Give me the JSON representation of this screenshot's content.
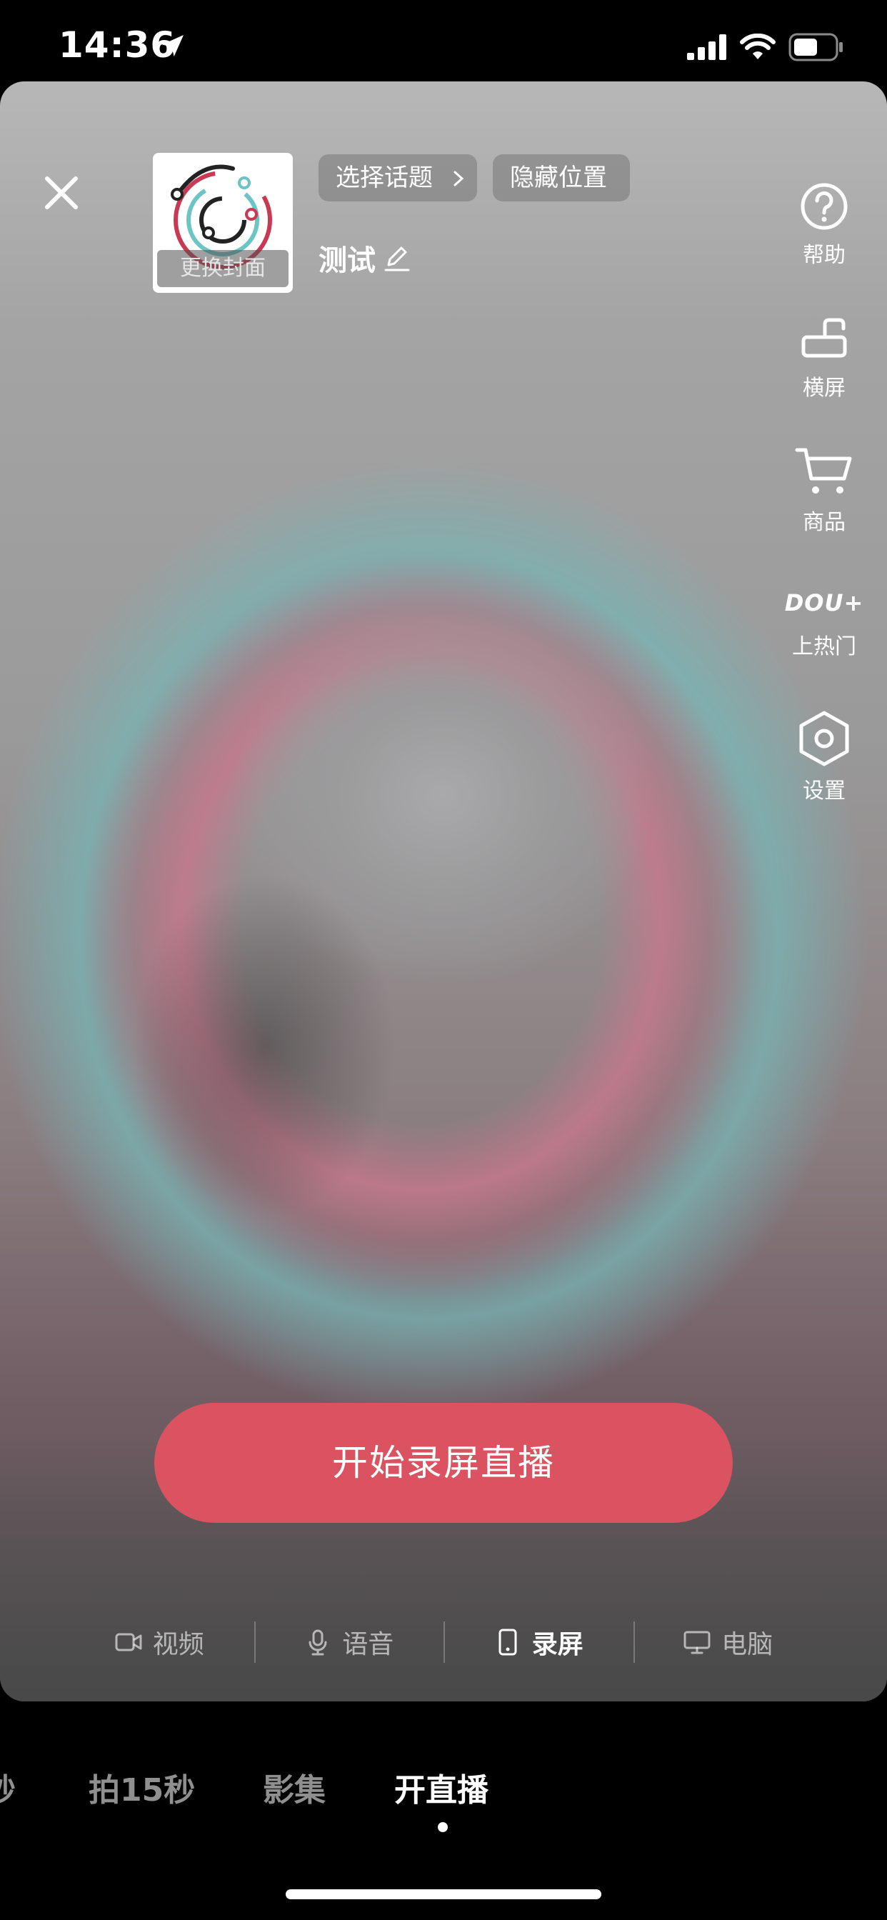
{
  "status_bar": {
    "time": "14:36",
    "icons": [
      "location-arrow-icon",
      "signal-icon",
      "wifi-icon",
      "battery-icon"
    ]
  },
  "header": {
    "cover_label": "更换封面",
    "topic_chip": "选择话题",
    "location_chip": "隐藏位置",
    "title": "测试"
  },
  "sidebar": {
    "items": [
      {
        "label": "帮助",
        "icon": "help-icon"
      },
      {
        "label": "横屏",
        "icon": "landscape-icon"
      },
      {
        "label": "商品",
        "icon": "cart-icon"
      },
      {
        "label": "上热门",
        "icon": "dou-plus-icon",
        "badge": "DOU+"
      },
      {
        "label": "设置",
        "icon": "settings-icon"
      }
    ]
  },
  "start_button": "开始录屏直播",
  "mode_tabs": [
    {
      "label": "视频",
      "icon": "video-camera-icon",
      "active": false
    },
    {
      "label": "语音",
      "icon": "microphone-icon",
      "active": false
    },
    {
      "label": "录屏",
      "icon": "phone-screen-icon",
      "active": true
    },
    {
      "label": "电脑",
      "icon": "monitor-icon",
      "active": false
    }
  ],
  "bottom_tabs": [
    {
      "label": "秒",
      "active": false
    },
    {
      "label": "拍15秒",
      "active": false
    },
    {
      "label": "影集",
      "active": false
    },
    {
      "label": "开直播",
      "active": true
    }
  ],
  "colors": {
    "accent": "#db5361",
    "background": "#000000"
  }
}
